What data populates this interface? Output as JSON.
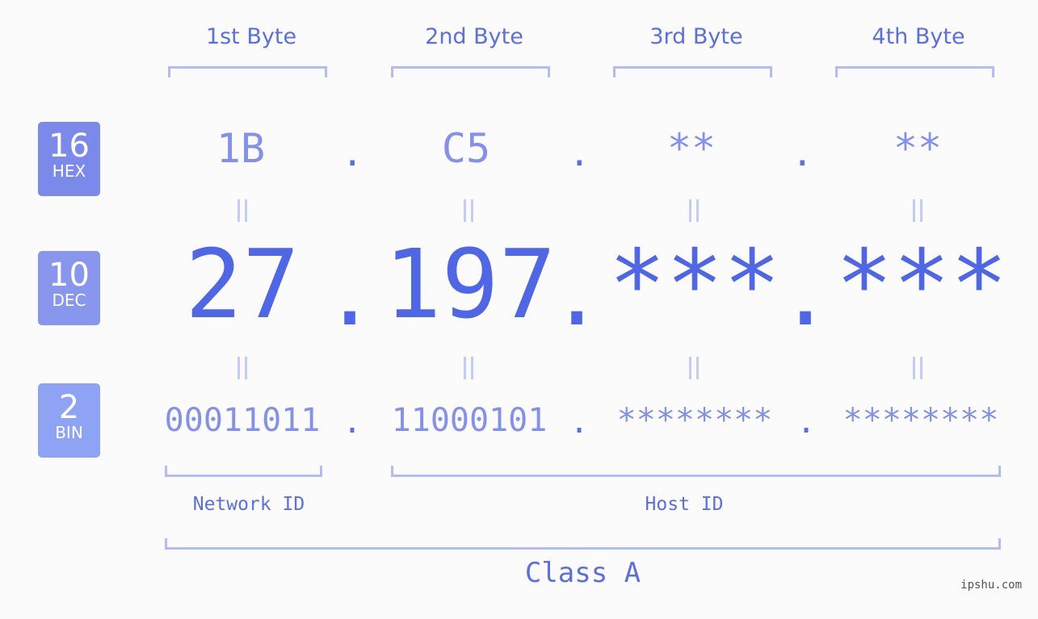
{
  "headers": [
    "1st Byte",
    "2nd Byte",
    "3rd Byte",
    "4th Byte"
  ],
  "badges": {
    "hex": {
      "num": "16",
      "label": "HEX",
      "color": "#7b89ea"
    },
    "dec": {
      "num": "10",
      "label": "DEC",
      "color": "#8896ee"
    },
    "bin": {
      "num": "2",
      "label": "BIN",
      "color": "#8fa3f5"
    }
  },
  "hex": [
    "1B",
    "C5",
    "**",
    "**"
  ],
  "dec": [
    "27",
    "197",
    "***",
    "***"
  ],
  "bin": [
    "00011011",
    "11000101",
    "********",
    "********"
  ],
  "separator": ".",
  "network_label": "Network ID",
  "host_label": "Host ID",
  "class_label": "Class A",
  "watermark": "ipshu.com"
}
